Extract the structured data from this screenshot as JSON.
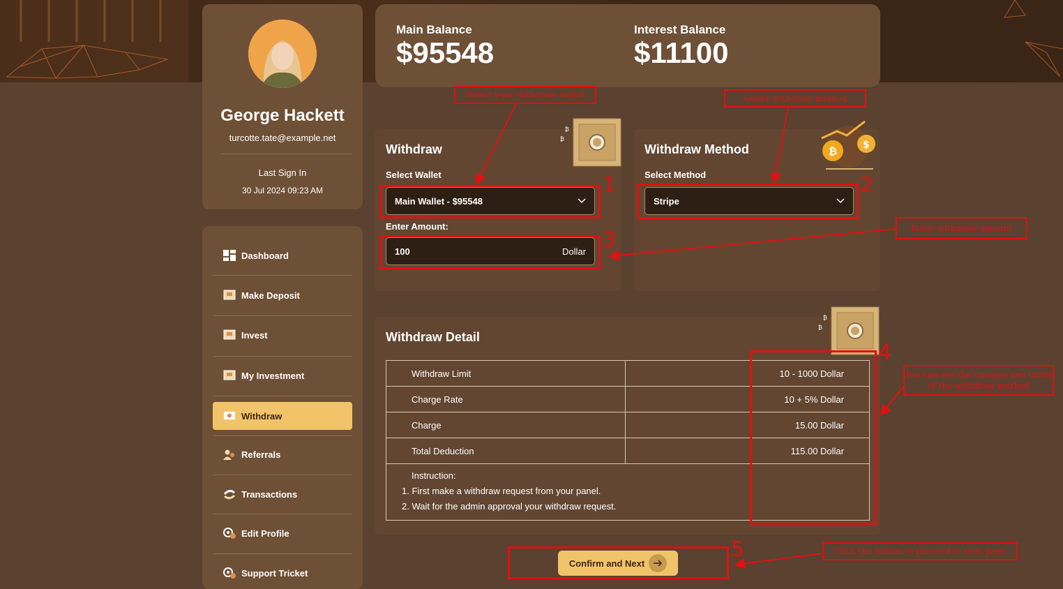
{
  "profile": {
    "name": "George Hackett",
    "email": "turcotte.tate@example.net",
    "last_sign_in_label": "Last Sign In",
    "last_sign_in": "30 Jul 2024 09:23 AM"
  },
  "nav": [
    {
      "label": "Dashboard",
      "icon": "dashboard-icon"
    },
    {
      "label": "Make Deposit",
      "icon": "deposit-icon"
    },
    {
      "label": "Invest",
      "icon": "invest-icon"
    },
    {
      "label": "My Investment",
      "icon": "investment-icon"
    },
    {
      "label": "Withdraw",
      "icon": "withdraw-icon",
      "active": true
    },
    {
      "label": "Referrals",
      "icon": "referrals-icon"
    },
    {
      "label": "Transactions",
      "icon": "transactions-icon"
    },
    {
      "label": "Edit Profile",
      "icon": "edit-profile-icon"
    },
    {
      "label": "Support Tricket",
      "icon": "support-icon"
    }
  ],
  "balances": {
    "main_label": "Main Balance",
    "main_value": "$95548",
    "interest_label": "Interest Balance",
    "interest_value": "$11100"
  },
  "withdraw": {
    "title": "Withdraw",
    "wallet_label": "Select Wallet",
    "wallet_value": "Main Wallet - $95548",
    "amount_label": "Enter Amount:",
    "amount_value": "100",
    "amount_unit": "Dollar"
  },
  "method": {
    "title": "Withdraw Method",
    "method_label": "Select Method",
    "method_value": "Stripe"
  },
  "detail": {
    "title": "Withdraw Detail",
    "rows": [
      {
        "label": "Withdraw Limit",
        "value": "10 - 1000 Dollar"
      },
      {
        "label": "Charge Rate",
        "value": "10 + 5% Dollar"
      },
      {
        "label": "Charge",
        "value": "15.00 Dollar"
      },
      {
        "label": "Total Deduction",
        "value": "115.00 Dollar"
      }
    ],
    "instruction_title": "Instruction:",
    "instructions": [
      "1. First make a withdraw request from your panel.",
      "2. Wait for the admin approval your withdraw request."
    ]
  },
  "confirm_label": "Confirm and Next",
  "annotations": {
    "wallet": "Select your withdraw wallet",
    "method": "Select withdraw method",
    "amount": "Enter withdraw amount",
    "charges": "You can see the charges and limits of the withdraw method",
    "button": "Click the button to procced to next page",
    "numbers": [
      "1",
      "2",
      "3",
      "4",
      "5"
    ]
  },
  "colors": {
    "background": "#5a4130",
    "card": "#6e5036",
    "accent": "#f2c46a",
    "annotation": "#e01010"
  }
}
